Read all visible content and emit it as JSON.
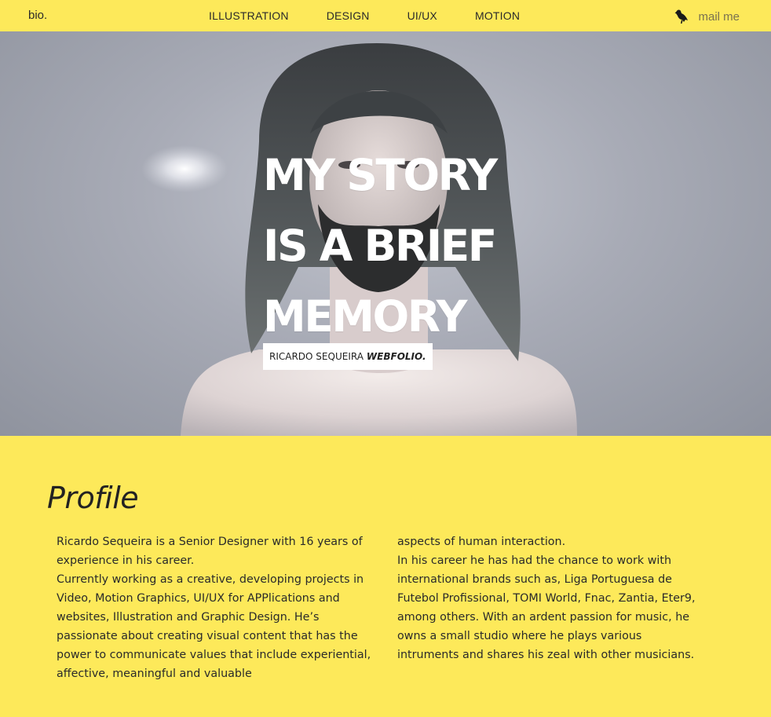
{
  "nav": {
    "brand": "bio.",
    "items": [
      "ILLUSTRATION",
      "DESIGN",
      "UI/UX",
      "MOTION"
    ],
    "mail_label": "mail me",
    "mail_icon": "bird-icon"
  },
  "hero": {
    "headline_lines": [
      "MY STORY",
      "IS A BRIEF",
      "MEMORY"
    ],
    "tag_name": "RICARDO SEQUEIRA",
    "tag_strong": "WEBFOLIO."
  },
  "profile": {
    "title": "Profile",
    "left_paragraphs": [
      "Ricardo Sequeira is a Senior Designer with 16 years of experience in his career.",
      "Currently working as a creative, developing projects in Video, Motion Graphics, UI/UX for APPlications and websites, Illustration and Graphic Design. He’s passionate about creating visual content that has the power to communicate values that include experiential, affective, meaningful and valuable"
    ],
    "right_paragraphs": [
      "aspects of human interaction.",
      "In his career he has had the chance to work with international brands such as, Liga Portuguesa de Futebol Profissional, TOMI World, Fnac, Zantia, Eter9, among others. With an ardent passion for music, he owns a small studio where he plays various intruments and shares his zeal with other musicians."
    ]
  },
  "colors": {
    "accent_yellow": "#fde95a",
    "hero_text": "#ffffff",
    "body_text": "#2a2a2a"
  }
}
